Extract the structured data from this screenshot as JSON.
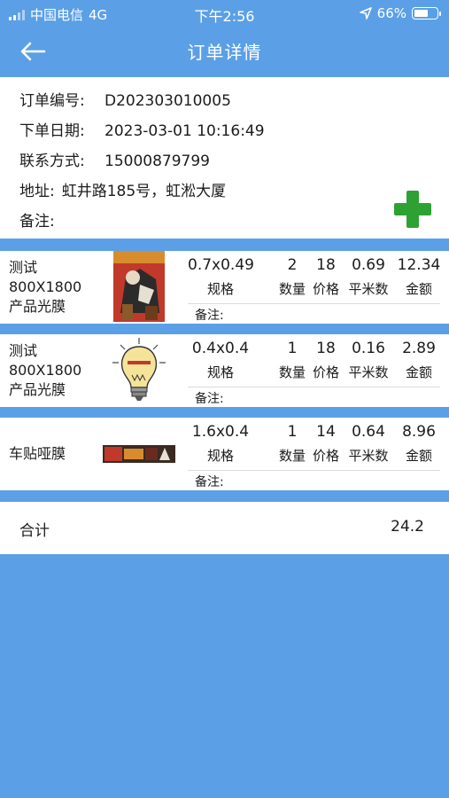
{
  "status_bar": {
    "carrier": "中国电信",
    "network": "4G",
    "time": "下午2:56",
    "battery_text": "66%",
    "battery_level": 0.66
  },
  "nav": {
    "title": "订单详情",
    "back_icon": "back-arrow-icon"
  },
  "order": {
    "number_label": "订单编号:",
    "number": "D202303010005",
    "date_label": "下单日期:",
    "date": "2023-03-01 10:16:49",
    "contact_label": "联系方式:",
    "contact": "15000879799",
    "address_label": "地址:",
    "address": "虹井路185号，虹淞大厦",
    "remark_label": "备注:",
    "remark": "",
    "add_icon": "plus-icon",
    "add_color": "#2da233"
  },
  "columns": {
    "spec": "规格",
    "qty": "数量",
    "price": "价格",
    "sqm": "平米数",
    "amount": "金额"
  },
  "items": [
    {
      "name_line1": "测试",
      "name_line2": "800X1800",
      "name_line3": "产品光膜",
      "spec": "0.7x0.49",
      "qty": "2",
      "price": "18",
      "sqm": "0.69",
      "amount": "12.34",
      "remark_label": "备注:",
      "thumb": "poster-image"
    },
    {
      "name_line1": "测试",
      "name_line2": "800X1800",
      "name_line3": "产品光膜",
      "spec": "0.4x0.4",
      "qty": "1",
      "price": "18",
      "sqm": "0.16",
      "amount": "2.89",
      "remark_label": "备注:",
      "thumb": "lightbulb-image"
    },
    {
      "name_line1": "车贴哑膜",
      "spec": "1.6x0.4",
      "qty": "1",
      "price": "14",
      "sqm": "0.64",
      "amount": "8.96",
      "remark_label": "备注:",
      "thumb": "banner-image"
    }
  ],
  "total": {
    "label": "合计",
    "value": "24.2"
  },
  "colors": {
    "primary": "#5ba0e6",
    "card": "#ffffff"
  }
}
